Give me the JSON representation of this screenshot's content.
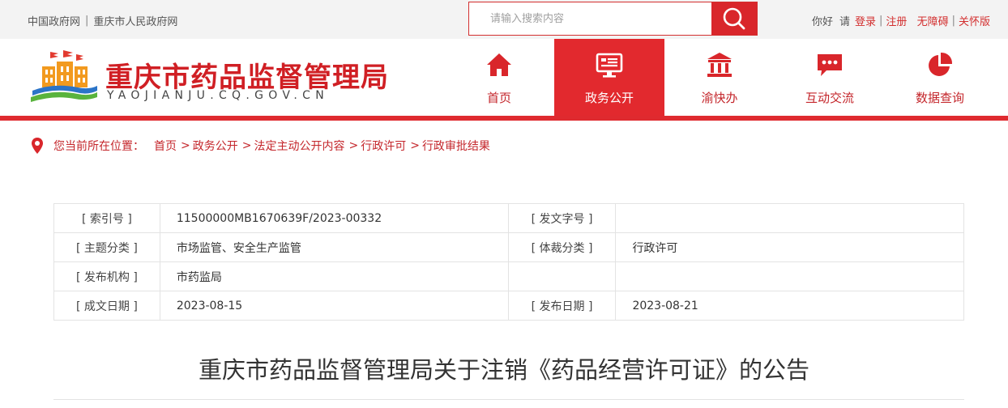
{
  "top_bar": {
    "links": [
      "中国政府网",
      "重庆市人民政府网"
    ],
    "search_placeholder": "请输入搜索内容",
    "greeting": "你好",
    "please": "请",
    "login": "登录",
    "register": "注册",
    "accessible": "无障碍",
    "care_mode": "关怀版"
  },
  "header": {
    "site_title": "重庆市药品监督管理局",
    "site_domain": "YAOJIANJU.CQ.GOV.CN"
  },
  "nav": {
    "items": [
      {
        "label": "首页",
        "icon": "home-icon"
      },
      {
        "label": "政务公开",
        "icon": "monitor-icon",
        "active": true
      },
      {
        "label": "渝快办",
        "icon": "government-building-icon"
      },
      {
        "label": "互动交流",
        "icon": "chat-icon"
      },
      {
        "label": "数据查询",
        "icon": "pie-chart-icon"
      }
    ]
  },
  "breadcrumb": {
    "lead": "您当前所在位置：",
    "items": [
      "首页",
      "政务公开",
      "法定主动公开内容",
      "行政许可",
      "行政审批结果"
    ]
  },
  "meta": {
    "index_no_label": "[ 索引号 ]",
    "index_no": "11500000MB1670639F/2023-00332",
    "doc_no_label": "[ 发文字号 ]",
    "doc_no": "",
    "topic_label": "[ 主题分类 ]",
    "topic": "市场监管、安全生产监管",
    "genre_label": "[ 体裁分类 ]",
    "genre": "行政许可",
    "issuer_label": "[ 发布机构 ]",
    "issuer": "市药监局",
    "created_label": "[ 成文日期 ]",
    "created": "2023-08-15",
    "published_label": "[ 发布日期 ]",
    "published": "2023-08-21"
  },
  "document": {
    "title": "重庆市药品监督管理局关于注销《药品经营许可证》的公告"
  },
  "colors": {
    "brand_red": "#d9262b",
    "nav_active": "#e2292e",
    "logo_orange": "#f29a1f",
    "logo_blue": "#2b74c8",
    "logo_green": "#59b33d"
  }
}
